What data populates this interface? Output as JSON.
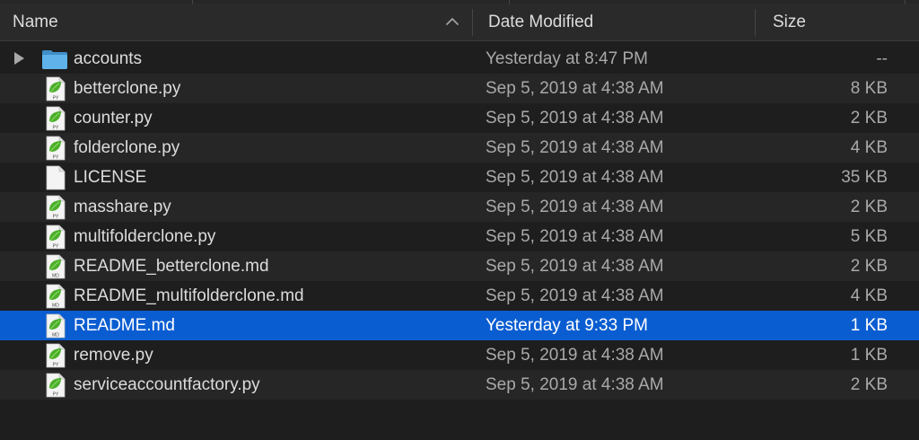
{
  "columns": {
    "name": "Name",
    "date": "Date Modified",
    "size": "Size"
  },
  "sort": {
    "column": "name",
    "direction": "ascending",
    "icon": "chevron-up-icon"
  },
  "colors": {
    "background": "#1e1e1e",
    "alt_row": "#262626",
    "selection": "#0a5dd1",
    "folder": "#5fb3ea",
    "leaf": "#4caf2a"
  },
  "files": [
    {
      "name": "accounts",
      "date": "Yesterday at 8:47 PM",
      "size": "--",
      "kind": "folder",
      "icon": "folder-icon",
      "badge": ""
    },
    {
      "name": "betterclone.py",
      "date": "Sep 5, 2019 at 4:38 AM",
      "size": "8 KB",
      "kind": "py",
      "icon": "python-file-icon",
      "badge": "PY"
    },
    {
      "name": "counter.py",
      "date": "Sep 5, 2019 at 4:38 AM",
      "size": "2 KB",
      "kind": "py",
      "icon": "python-file-icon",
      "badge": "PY"
    },
    {
      "name": "folderclone.py",
      "date": "Sep 5, 2019 at 4:38 AM",
      "size": "4 KB",
      "kind": "py",
      "icon": "python-file-icon",
      "badge": "PY"
    },
    {
      "name": "LICENSE",
      "date": "Sep 5, 2019 at 4:38 AM",
      "size": "35 KB",
      "kind": "blank",
      "icon": "blank-file-icon",
      "badge": ""
    },
    {
      "name": "masshare.py",
      "date": "Sep 5, 2019 at 4:38 AM",
      "size": "2 KB",
      "kind": "py",
      "icon": "python-file-icon",
      "badge": "PY"
    },
    {
      "name": "multifolderclone.py",
      "date": "Sep 5, 2019 at 4:38 AM",
      "size": "5 KB",
      "kind": "py",
      "icon": "python-file-icon",
      "badge": "PY"
    },
    {
      "name": "README_betterclone.md",
      "date": "Sep 5, 2019 at 4:38 AM",
      "size": "2 KB",
      "kind": "md",
      "icon": "markdown-file-icon",
      "badge": "MD"
    },
    {
      "name": "README_multifolderclone.md",
      "date": "Sep 5, 2019 at 4:38 AM",
      "size": "4 KB",
      "kind": "md",
      "icon": "markdown-file-icon",
      "badge": "MD"
    },
    {
      "name": "README.md",
      "date": "Yesterday at 9:33 PM",
      "size": "1 KB",
      "kind": "md",
      "icon": "markdown-file-icon",
      "badge": "MD",
      "selected": true
    },
    {
      "name": "remove.py",
      "date": "Sep 5, 2019 at 4:38 AM",
      "size": "1 KB",
      "kind": "py",
      "icon": "python-file-icon",
      "badge": "PY"
    },
    {
      "name": "serviceaccountfactory.py",
      "date": "Sep 5, 2019 at 4:38 AM",
      "size": "2 KB",
      "kind": "py",
      "icon": "python-file-icon",
      "badge": "PY"
    }
  ]
}
